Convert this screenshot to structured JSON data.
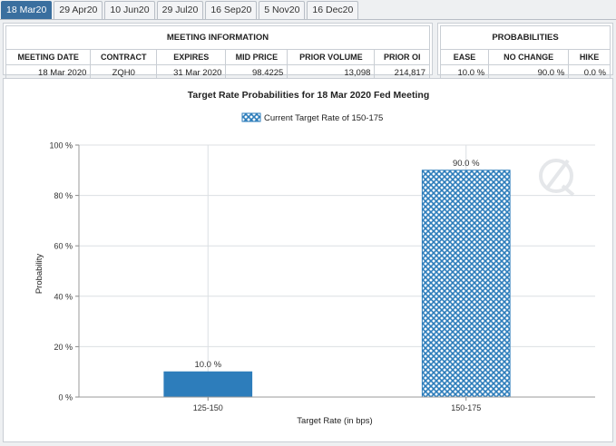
{
  "tabs": [
    "18 Mar20",
    "29 Apr20",
    "10 Jun20",
    "29 Jul20",
    "16 Sep20",
    "5 Nov20",
    "16 Dec20"
  ],
  "active_tab": 0,
  "meeting_info": {
    "title": "MEETING INFORMATION",
    "headers": [
      "MEETING DATE",
      "CONTRACT",
      "EXPIRES",
      "MID PRICE",
      "PRIOR VOLUME",
      "PRIOR OI"
    ],
    "values": [
      "18 Mar 2020",
      "ZQH0",
      "31 Mar 2020",
      "98.4225",
      "13,098",
      "214,817"
    ]
  },
  "probabilities": {
    "title": "PROBABILITIES",
    "headers": [
      "EASE",
      "NO CHANGE",
      "HIKE"
    ],
    "values": [
      "10.0 %",
      "90.0 %",
      "0.0 %"
    ]
  },
  "colors": {
    "active_tab": "#3a6f9f",
    "bar_solid": "#2d7dbb",
    "bar_hatch": "#2d7dbb"
  },
  "chart_data": {
    "type": "bar",
    "title": "Target Rate Probabilities for 18 Mar 2020 Fed Meeting",
    "legend": "Current Target Rate of 150-175",
    "legend_position": "top-center",
    "xlabel": "Target Rate (in bps)",
    "ylabel": "Probability",
    "categories": [
      "125-150",
      "150-175"
    ],
    "values": [
      10.0,
      90.0
    ],
    "data_labels": [
      "10.0 %",
      "90.0 %"
    ],
    "highlighted_category": "150-175",
    "ylim": [
      0,
      100
    ],
    "yticks": [
      0,
      20,
      40,
      60,
      80,
      100
    ],
    "ytick_labels": [
      "0 %",
      "20 %",
      "40 %",
      "60 %",
      "80 %",
      "100 %"
    ],
    "grid": true
  }
}
